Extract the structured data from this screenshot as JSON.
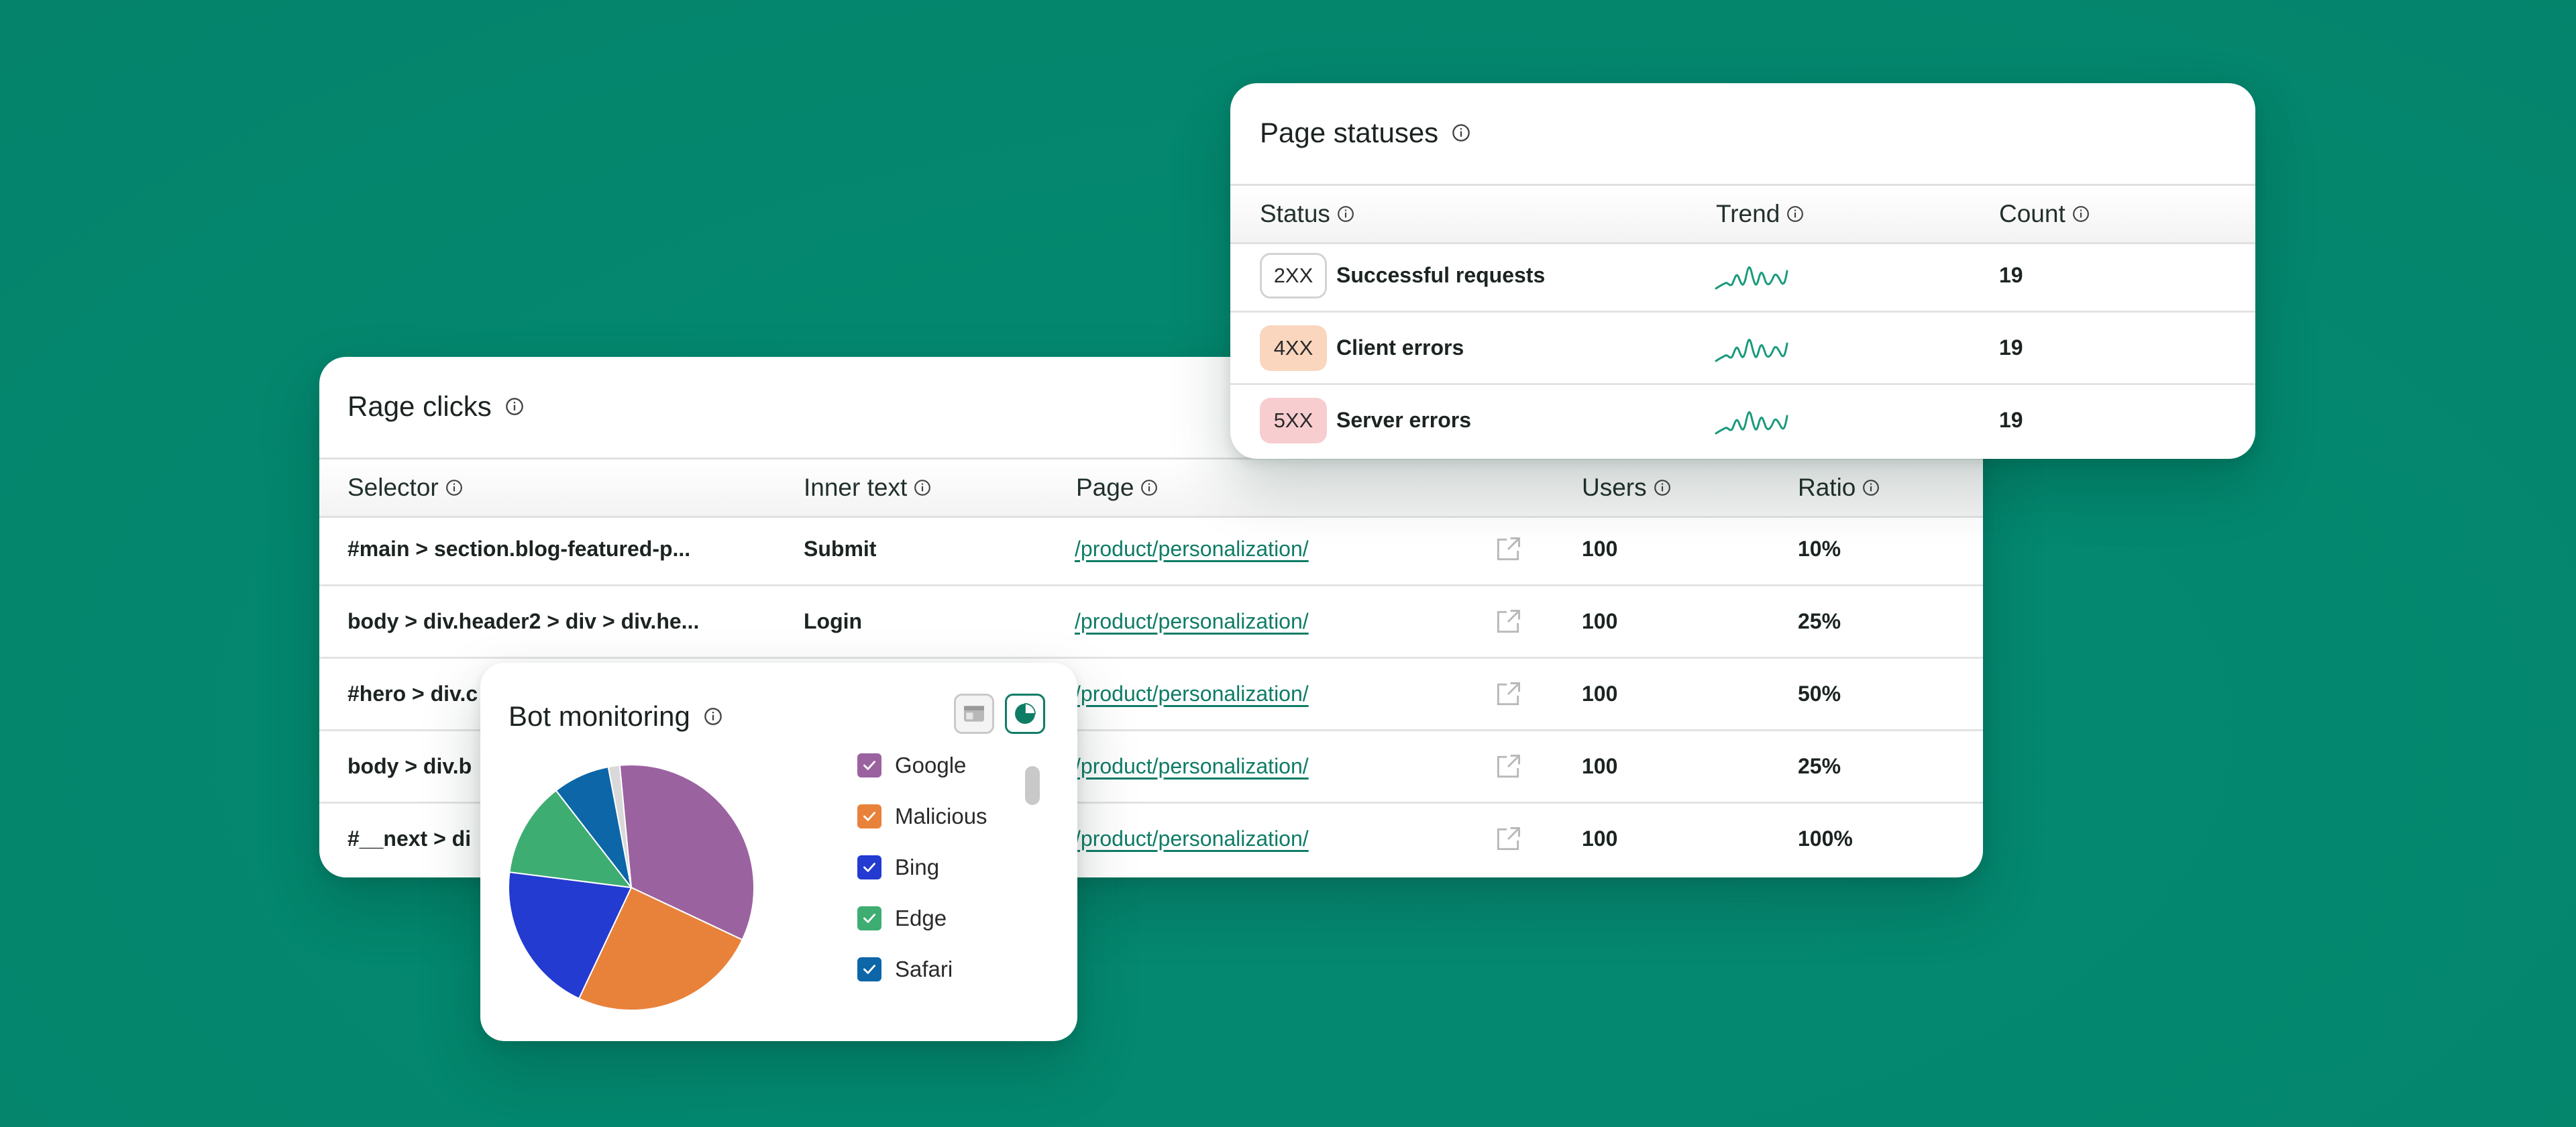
{
  "rage_clicks": {
    "title": "Rage clicks",
    "headers": {
      "selector": "Selector",
      "inner_text": "Inner text",
      "page": "Page",
      "users": "Users",
      "ratio": "Ratio"
    },
    "rows": [
      {
        "selector": "#main > section.blog-featured-p...",
        "inner_text": "Submit",
        "page": "/product/personalization/",
        "users": "100",
        "ratio": "10%"
      },
      {
        "selector": "body > div.header2 > div > div.he...",
        "inner_text": "Login",
        "page": "/product/personalization/",
        "users": "100",
        "ratio": "25%"
      },
      {
        "selector": "#hero > div.c",
        "inner_text": "",
        "page": "/product/personalization/",
        "users": "100",
        "ratio": "50%"
      },
      {
        "selector": "body > div.b",
        "inner_text": "",
        "page": "/product/personalization/",
        "users": "100",
        "ratio": "25%"
      },
      {
        "selector": "#__next > di",
        "inner_text": "",
        "page": "/product/personalization/",
        "users": "100",
        "ratio": "100%"
      }
    ]
  },
  "page_statuses": {
    "title": "Page statuses",
    "headers": {
      "status": "Status",
      "trend": "Trend",
      "count": "Count"
    },
    "rows": [
      {
        "code": "2XX",
        "label": "Successful requests",
        "count": "19"
      },
      {
        "code": "4XX",
        "label": "Client errors",
        "count": "19"
      },
      {
        "code": "5XX",
        "label": "Server errors",
        "count": "19"
      }
    ]
  },
  "bot_monitoring": {
    "title": "Bot monitoring",
    "legend": [
      {
        "label": "Google",
        "color": "#9b62a0",
        "checked": true
      },
      {
        "label": "Malicious",
        "color": "#e8823a",
        "checked": true
      },
      {
        "label": "Bing",
        "color": "#233bd0",
        "checked": true
      },
      {
        "label": "Edge",
        "color": "#3ead72",
        "checked": true
      },
      {
        "label": "Safari",
        "color": "#0c66a8",
        "checked": true
      }
    ],
    "pie_share": [
      {
        "label": "Google",
        "value": 0.335,
        "color": "#9b62a0"
      },
      {
        "label": "Malicious",
        "value": 0.25,
        "color": "#e8823a"
      },
      {
        "label": "Bing",
        "value": 0.2,
        "color": "#233bd0"
      },
      {
        "label": "Edge",
        "value": 0.125,
        "color": "#3ead72"
      },
      {
        "label": "Safari",
        "value": 0.075,
        "color": "#0c66a8"
      },
      {
        "label": "Other",
        "value": 0.015,
        "color": "#d9d9d9"
      }
    ]
  },
  "colors": {
    "background": "#04886f",
    "accent": "#0f7c66",
    "trend_line": "#1a9a7c"
  },
  "icons": {
    "info": "info-icon",
    "external_link": "external-link-icon",
    "table_view": "table-view-icon",
    "pie_view": "pie-chart-icon",
    "check": "check-icon"
  }
}
